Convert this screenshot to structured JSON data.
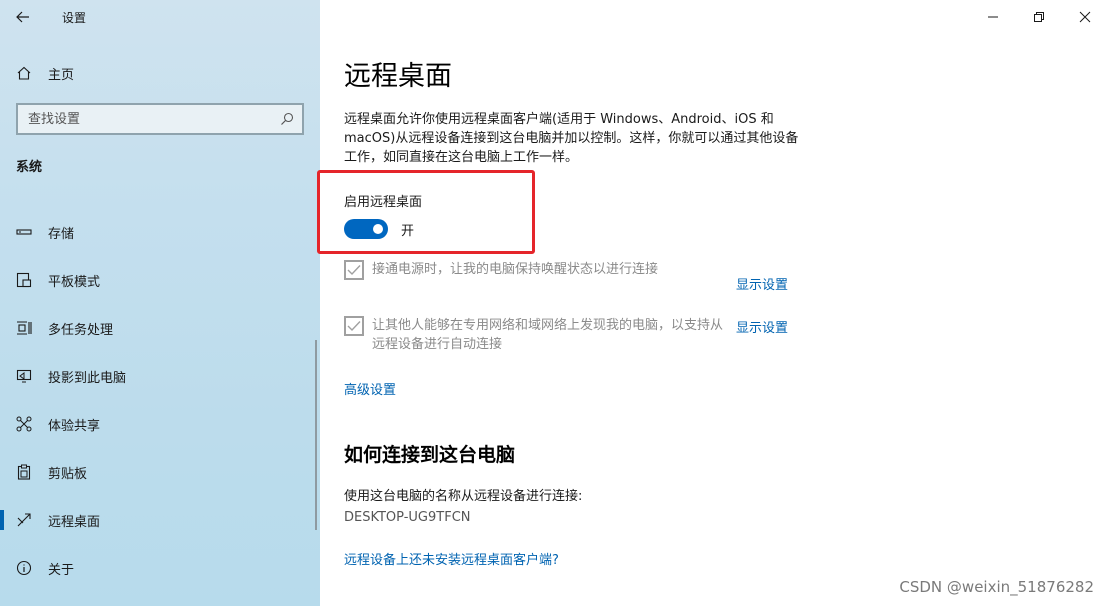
{
  "app": {
    "title": "设置"
  },
  "sidebar": {
    "home_label": "主页",
    "search_placeholder": "查找设置",
    "section_title": "系统",
    "items": [
      {
        "label": "存储",
        "icon": "storage-icon"
      },
      {
        "label": "平板模式",
        "icon": "tablet-mode-icon"
      },
      {
        "label": "多任务处理",
        "icon": "multitasking-icon"
      },
      {
        "label": "投影到此电脑",
        "icon": "project-icon"
      },
      {
        "label": "体验共享",
        "icon": "shared-experiences-icon"
      },
      {
        "label": "剪贴板",
        "icon": "clipboard-icon"
      },
      {
        "label": "远程桌面",
        "icon": "remote-desktop-icon",
        "active": true
      },
      {
        "label": "关于",
        "icon": "info-icon"
      }
    ]
  },
  "main": {
    "title": "远程桌面",
    "description": "远程桌面允许你使用远程桌面客户端(适用于 Windows、Android、iOS 和 macOS)从远程设备连接到这台电脑并加以控制。这样，你就可以通过其他设备工作，如同直接在这台电脑上工作一样。",
    "toggle_label": "启用远程桌面",
    "toggle_state": "开",
    "option1_text": "接通电源时，让我的电脑保持唤醒状态以进行连接",
    "option2_text": "让其他人能够在专用网络和域网络上发现我的电脑，以支持从远程设备进行自动连接",
    "show_settings_label": "显示设置",
    "advanced_label": "高级设置",
    "connect_heading": "如何连接到这台电脑",
    "connect_text": "使用这台电脑的名称从远程设备进行连接:",
    "pc_name": "DESKTOP-UG9TFCN",
    "client_link": "远程设备上还未安装远程桌面客户端?"
  },
  "watermark": "CSDN @weixin_51876282",
  "colors": {
    "accent": "#0067c0",
    "highlight": "#e5252a",
    "link": "#0063b1"
  }
}
